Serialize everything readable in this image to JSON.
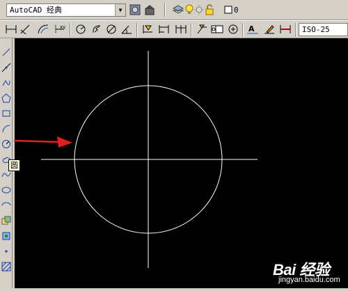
{
  "toolbar_top": {
    "workspace_select": "AutoCAD 经典",
    "layer_value": "0",
    "icons": [
      "workspace-settings-icon",
      "my-workspace-icon",
      "layer-manager-icon",
      "lightbulb-icon",
      "sun-icon",
      "lock-icon",
      "color-swatch-icon"
    ]
  },
  "toolbar_dims": {
    "dimstyle_select": "ISO-25",
    "icons": [
      "linear-dimension-icon",
      "aligned-dimension-icon",
      "arc-length-icon",
      "ordinate-icon",
      "radius-icon",
      "jogged-icon",
      "diameter-icon",
      "angular-icon",
      "quick-dimension-icon",
      "baseline-icon",
      "continue-icon",
      "quick-leader-icon",
      "tolerance-icon",
      "center-mark-icon",
      "dimension-edit-icon",
      "dimension-text-edit-icon",
      "dimension-update-icon"
    ]
  },
  "draw_toolbar": {
    "tools": [
      "line",
      "construction-line",
      "polyline",
      "polygon",
      "rectangle",
      "arc",
      "circle",
      "revision-cloud",
      "spline",
      "ellipse",
      "ellipse-arc",
      "insert-block",
      "make-block",
      "point",
      "hatch"
    ],
    "tooltip": "圆"
  },
  "canvas": {
    "background": "#000000",
    "entity_color": "#ffffff",
    "arrow_color": "#e02020"
  },
  "watermark": {
    "main": "Bai 经验",
    "sub": "jingyan.baidu.com"
  }
}
